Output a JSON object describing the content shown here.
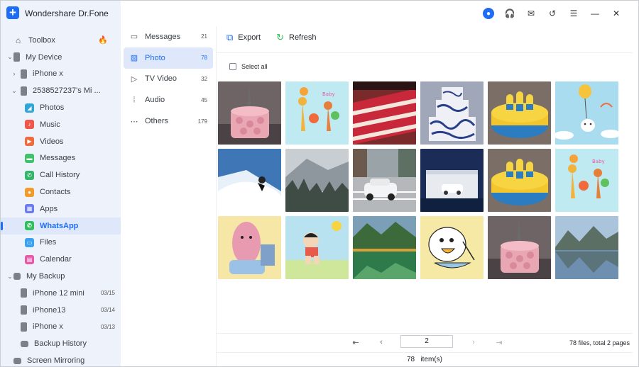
{
  "app": {
    "title": "Wondershare Dr.Fone"
  },
  "sidebar": {
    "items": [
      {
        "label": "Toolbox",
        "date": ""
      },
      {
        "label": "My Device",
        "date": ""
      },
      {
        "label": "iPhone x",
        "date": ""
      },
      {
        "label": "2538527237's Mi ...",
        "date": ""
      },
      {
        "label": "Photos",
        "date": ""
      },
      {
        "label": "Music",
        "date": ""
      },
      {
        "label": "Videos",
        "date": ""
      },
      {
        "label": "Messages",
        "date": ""
      },
      {
        "label": "Call History",
        "date": ""
      },
      {
        "label": "Contacts",
        "date": ""
      },
      {
        "label": "Apps",
        "date": ""
      },
      {
        "label": "WhatsApp",
        "date": ""
      },
      {
        "label": "Files",
        "date": ""
      },
      {
        "label": "Calendar",
        "date": ""
      },
      {
        "label": "My Backup",
        "date": ""
      },
      {
        "label": "iPhone 12 mini",
        "date": "03/15"
      },
      {
        "label": "iPhone13",
        "date": "03/14"
      },
      {
        "label": "iPhone x",
        "date": "03/13"
      },
      {
        "label": "Backup History",
        "date": ""
      },
      {
        "label": "Screen Mirroring",
        "date": ""
      }
    ],
    "icon_colors": {
      "photos": "#2fa6d6",
      "music": "#f0564a",
      "videos": "#f06a3c",
      "messages": "#3ec36a",
      "call_history": "#33b56a",
      "contacts": "#f39a2b",
      "apps": "#6a7cf0",
      "whatsapp": "#2fc05a",
      "files": "#3aa2f0",
      "calendar": "#e85aa8"
    }
  },
  "categories": [
    {
      "label": "Messages",
      "count": "21",
      "icon": "message-icon"
    },
    {
      "label": "Photo",
      "count": "78",
      "icon": "image-icon"
    },
    {
      "label": "TV Video",
      "count": "32",
      "icon": "video-icon"
    },
    {
      "label": "Audio",
      "count": "45",
      "icon": "audio-icon"
    },
    {
      "label": "Others",
      "count": "179",
      "icon": "more-icon"
    }
  ],
  "toolbar": {
    "export_label": "Export",
    "refresh_label": "Refresh",
    "select_all_label": "Select all"
  },
  "photos": [
    "pink cake with eiffel tower",
    "giraffes cartoon",
    "red velvet cake slice",
    "blue and white wedding cake",
    "minions cake",
    "cat with balloon cartoon",
    "snowboarder in powder",
    "misty mountain forest",
    "white car on city street",
    "white car in garage",
    "minions cake",
    "giraffes cartoon",
    "pink cartoon character",
    "cartoon boy running",
    "mountain lake reflection",
    "duck eating cartoon",
    "pink cake with eiffel tower",
    "lake with mountains"
  ],
  "pagination": {
    "page_value": "2",
    "file_info": "78 files, total 2 pages"
  },
  "status": {
    "count": "78",
    "unit": "item(s)"
  },
  "colors": {
    "accent": "#1e6ef5",
    "sidebar_bg": "#eef2fa",
    "active_bg": "#dfe7fb"
  }
}
